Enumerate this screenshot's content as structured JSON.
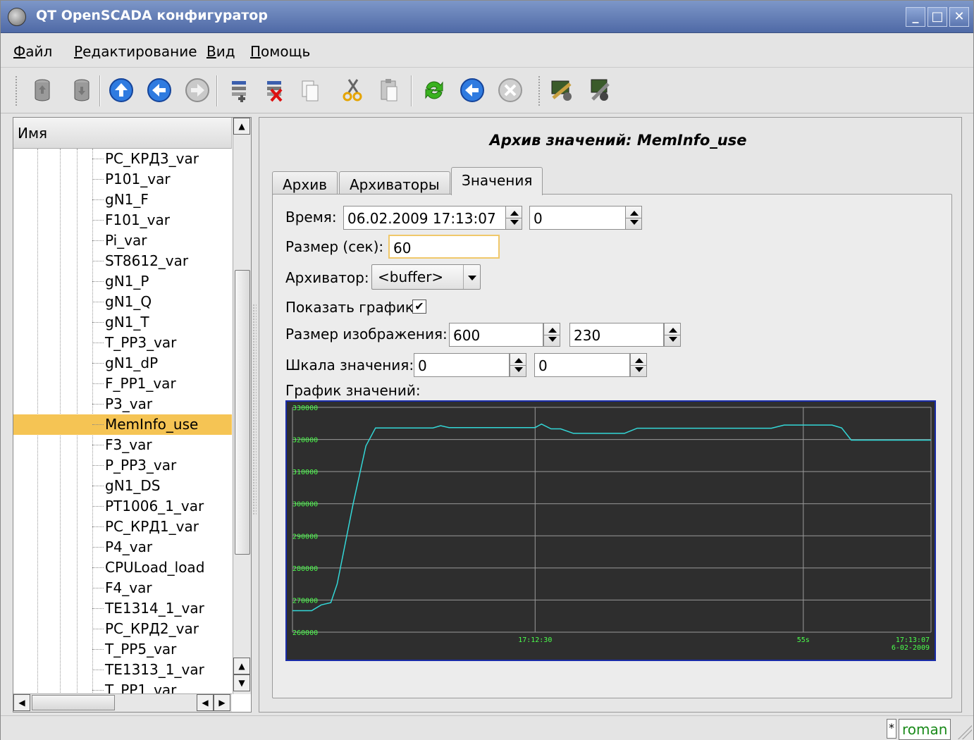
{
  "window": {
    "title": "QT OpenSCADA конфигуратор",
    "buttons": [
      "_",
      "□",
      "✕"
    ]
  },
  "menu": [
    {
      "label": "Файл",
      "mnemonic": "Ф",
      "rest": "айл"
    },
    {
      "label": "Редактирование",
      "mnemonic": "Р",
      "rest": "едактирование"
    },
    {
      "label": "Вид",
      "mnemonic": "В",
      "rest": "ид"
    },
    {
      "label": "Помощь",
      "mnemonic": "П",
      "rest": "омощь"
    }
  ],
  "toolbar": {
    "icons": [
      "db-load-icon",
      "db-save-icon",
      "up-icon",
      "back-icon",
      "forward-icon",
      "add-item-icon",
      "delete-item-icon",
      "copy-icon",
      "cut-icon",
      "paste-icon",
      "refresh-icon",
      "start-icon",
      "stop-icon",
      "station-config-icon",
      "station-tools-icon"
    ]
  },
  "tree": {
    "header": "Имя",
    "selected_index": 13,
    "items": [
      "PC_КРД3_var",
      "P101_var",
      "gN1_F",
      "F101_var",
      "Pi_var",
      "ST8612_var",
      "gN1_P",
      "gN1_Q",
      "gN1_T",
      "T_PP3_var",
      "gN1_dP",
      "F_PP1_var",
      "P3_var",
      "MemInfo_use",
      "F3_var",
      "P_PP3_var",
      "gN1_DS",
      "PT1006_1_var",
      "PC_КРД1_var",
      "P4_var",
      "CPULoad_load",
      "F4_var",
      "TE1314_1_var",
      "PC_КРД2_var",
      "T_PP5_var",
      "TE1313_1_var",
      "T_PP1_var"
    ]
  },
  "panel": {
    "title": "Архив значений: MemInfo_use",
    "tabs": [
      "Архив",
      "Архиваторы",
      "Значения"
    ],
    "active_tab": "Значения"
  },
  "form": {
    "time_label": "Время:",
    "time_value": "06.02.2009 17:13:07",
    "time_usec": "0",
    "size_label": "Размер (сек):",
    "size_value": "60",
    "archiver_label": "Архиватор:",
    "archiver_value": "<buffer>",
    "show_graph_label": "Показать график:",
    "show_graph_checked": "✔",
    "img_size_label": "Размер изображения:",
    "img_width": "600",
    "img_height": "230",
    "scale_label": "Шкала значения:",
    "scale_min": "0",
    "scale_max": "0",
    "graph_label": "График значений:"
  },
  "chart_data": {
    "type": "line",
    "ylim": [
      260000,
      330000
    ],
    "y_ticks": [
      260000,
      270000,
      280000,
      290000,
      300000,
      310000,
      320000,
      330000
    ],
    "x_labels": [
      {
        "t": 0.38,
        "text": "17:12:30"
      },
      {
        "t": 0.8,
        "text": "55s"
      }
    ],
    "end_label": [
      "17:13:07",
      "6-02-2009"
    ],
    "grid": true,
    "colors": {
      "background": "#2e2e2e",
      "grid": "#9a9a9a",
      "line": "#33d7d7",
      "labels": "#4cff4c"
    },
    "series": [
      {
        "points": [
          [
            0,
            266700
          ],
          [
            0.03,
            266700
          ],
          [
            0.045,
            268500
          ],
          [
            0.06,
            269200
          ],
          [
            0.07,
            275000
          ],
          [
            0.08,
            285000
          ],
          [
            0.095,
            300000
          ],
          [
            0.115,
            318000
          ],
          [
            0.13,
            323600
          ],
          [
            0.14,
            323600
          ],
          [
            0.22,
            323600
          ],
          [
            0.232,
            324300
          ],
          [
            0.245,
            323700
          ],
          [
            0.34,
            323700
          ],
          [
            0.38,
            323700
          ],
          [
            0.39,
            324800
          ],
          [
            0.405,
            323300
          ],
          [
            0.42,
            323300
          ],
          [
            0.44,
            321900
          ],
          [
            0.52,
            321900
          ],
          [
            0.54,
            323500
          ],
          [
            0.75,
            323500
          ],
          [
            0.77,
            324500
          ],
          [
            0.8,
            324500
          ],
          [
            0.845,
            324500
          ],
          [
            0.86,
            323600
          ],
          [
            0.875,
            319800
          ],
          [
            1.0,
            319800
          ]
        ]
      }
    ]
  },
  "statusbar": {
    "modified": "*",
    "user": "roman"
  }
}
